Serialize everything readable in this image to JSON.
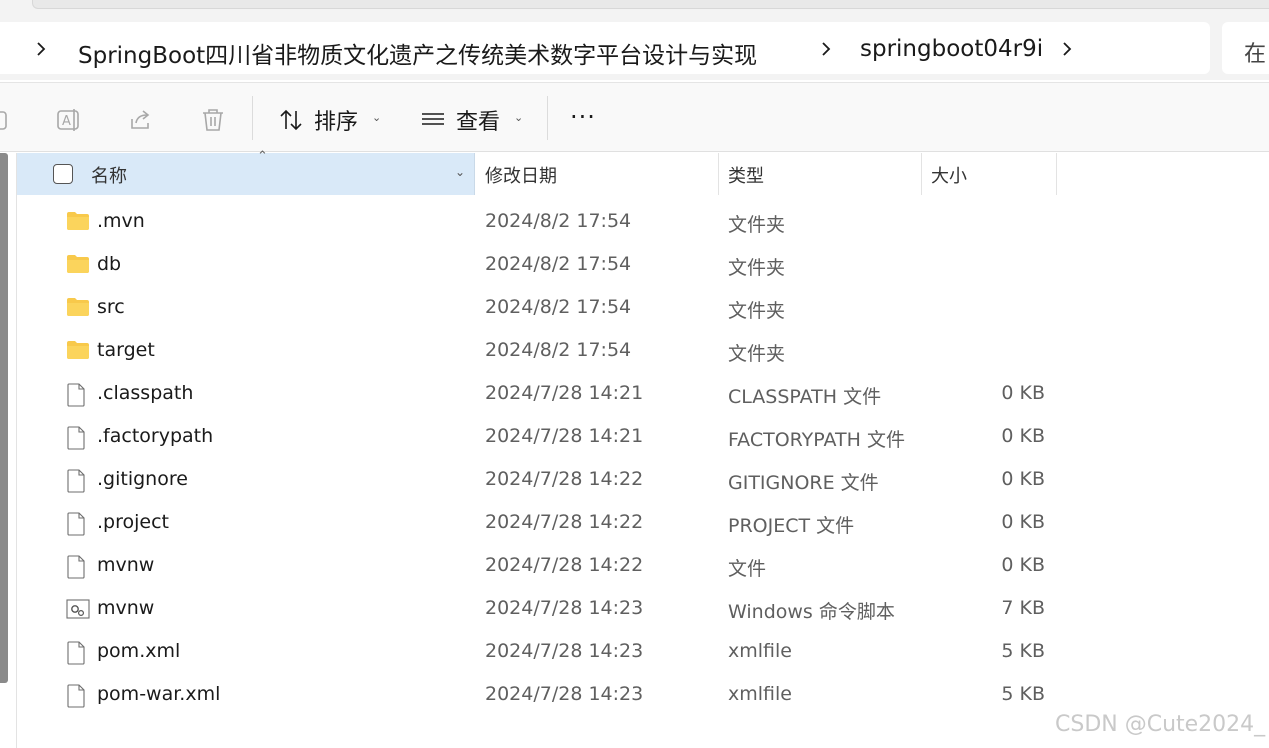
{
  "breadcrumb": {
    "items": [
      "SpringBoot四川省非物质文化遗产之传统美术数字平台设计与实现",
      "springboot04r9i"
    ],
    "search_partial": "在"
  },
  "toolbar": {
    "sort_label": "排序",
    "view_label": "查看",
    "more_label": "···"
  },
  "columns": {
    "name": "名称",
    "date": "修改日期",
    "type": "类型",
    "size": "大小"
  },
  "files": [
    {
      "name": ".mvn",
      "date": "2024/8/2 17:54",
      "type": "文件夹",
      "size": "",
      "icon": "folder-icon"
    },
    {
      "name": "db",
      "date": "2024/8/2 17:54",
      "type": "文件夹",
      "size": "",
      "icon": "folder-icon"
    },
    {
      "name": "src",
      "date": "2024/8/2 17:54",
      "type": "文件夹",
      "size": "",
      "icon": "folder-icon"
    },
    {
      "name": "target",
      "date": "2024/8/2 17:54",
      "type": "文件夹",
      "size": "",
      "icon": "folder-icon"
    },
    {
      "name": ".classpath",
      "date": "2024/7/28 14:21",
      "type": "CLASSPATH 文件",
      "size": "0 KB",
      "icon": "file-icon"
    },
    {
      "name": ".factorypath",
      "date": "2024/7/28 14:21",
      "type": "FACTORYPATH 文件",
      "size": "0 KB",
      "icon": "file-icon"
    },
    {
      "name": ".gitignore",
      "date": "2024/7/28 14:22",
      "type": "GITIGNORE 文件",
      "size": "0 KB",
      "icon": "file-icon"
    },
    {
      "name": ".project",
      "date": "2024/7/28 14:22",
      "type": "PROJECT 文件",
      "size": "0 KB",
      "icon": "file-icon"
    },
    {
      "name": "mvnw",
      "date": "2024/7/28 14:22",
      "type": "文件",
      "size": "0 KB",
      "icon": "file-icon"
    },
    {
      "name": "mvnw",
      "date": "2024/7/28 14:23",
      "type": "Windows 命令脚本",
      "size": "7 KB",
      "icon": "script-icon"
    },
    {
      "name": "pom.xml",
      "date": "2024/7/28 14:23",
      "type": "xmlfile",
      "size": "5 KB",
      "icon": "file-icon"
    },
    {
      "name": "pom-war.xml",
      "date": "2024/7/28 14:23",
      "type": "xmlfile",
      "size": "5 KB",
      "icon": "file-icon"
    }
  ],
  "watermark": "CSDN @Cute2024_",
  "colors": {
    "header_selected": "#d9e9f8",
    "folder": "#f8c94b",
    "accent": "#0067c0"
  }
}
